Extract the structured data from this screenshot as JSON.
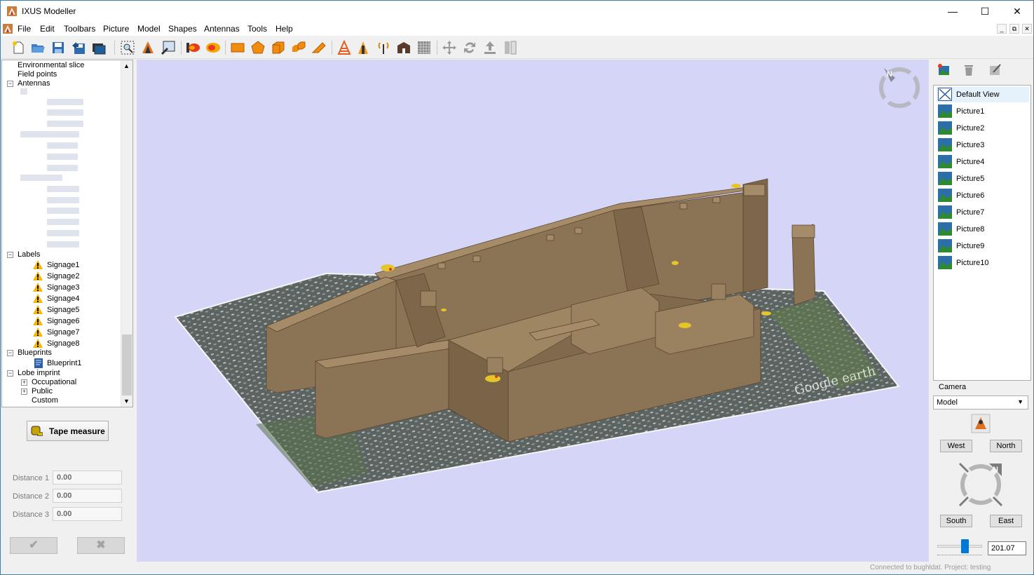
{
  "app": {
    "title": "IXUS Modeller"
  },
  "window_controls": {
    "minimize": "—",
    "maximize": "☐",
    "close": "✕"
  },
  "menu": [
    "File",
    "Edit",
    "Toolbars",
    "Picture",
    "Model",
    "Shapes",
    "Antennas",
    "Tools",
    "Help"
  ],
  "mdi_controls": {
    "minimize": "_",
    "restore": "⧉",
    "close": "✕"
  },
  "tree": {
    "env_slice": "Environmental slice",
    "field_points": "Field points",
    "antennas": "Antennas",
    "labels": "Labels",
    "signage": [
      "Signage1",
      "Signage2",
      "Signage3",
      "Signage4",
      "Signage5",
      "Signage6",
      "Signage7",
      "Signage8"
    ],
    "blueprints": "Blueprints",
    "blueprint1": "Blueprint1",
    "lobe_imprint": "Lobe imprint",
    "occupational": "Occupational",
    "public": "Public",
    "custom": "Custom"
  },
  "tape": {
    "button": "Tape measure",
    "distances": [
      {
        "label": "Distance 1",
        "value": "0.00"
      },
      {
        "label": "Distance 2",
        "value": "0.00"
      },
      {
        "label": "Distance 3",
        "value": "0.00"
      }
    ],
    "ok": "✔",
    "cancel": "✖"
  },
  "viewport": {
    "compass_letter": "N",
    "map_watermark": "Google earth",
    "background": "#d5d5f8",
    "building_color": "#8b7355"
  },
  "pictures": [
    "Default View",
    "Picture1",
    "Picture2",
    "Picture3",
    "Picture4",
    "Picture5",
    "Picture6",
    "Picture7",
    "Picture8",
    "Picture9",
    "Picture10"
  ],
  "camera": {
    "label": "Camera",
    "mode": "Model",
    "west": "West",
    "north": "North",
    "south": "South",
    "east": "East",
    "compass_letter": "N",
    "zoom": "201.07"
  },
  "status": "Connected to bughldat. Project: testing"
}
